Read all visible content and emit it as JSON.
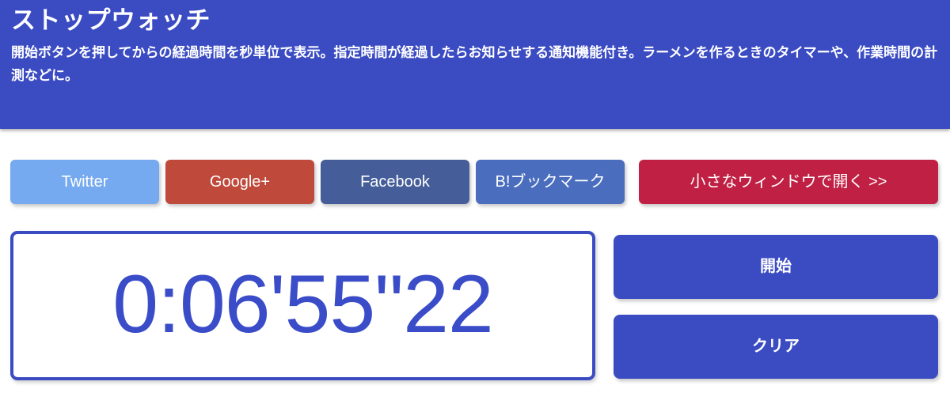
{
  "header": {
    "title": "ストップウォッチ",
    "description": "開始ボタンを押してからの経過時間を秒単位で表示。指定時間が経過したらお知らせする通知機能付き。ラーメンを作るときのタイマーや、作業時間の計測などに。",
    "background_color": "#3b4cc3",
    "text_color": "#ffffff"
  },
  "share_buttons": [
    {
      "label": "Twitter",
      "color": "#76aaf0",
      "name": "twitter"
    },
    {
      "label": "Google+",
      "color": "#bf4a3c",
      "name": "google-plus"
    },
    {
      "label": "Facebook",
      "color": "#455e99",
      "name": "facebook"
    },
    {
      "label": "B!ブックマーク",
      "color": "#4a6dbe",
      "name": "hatena-bookmark"
    }
  ],
  "open_window_button": {
    "label": "小さなウィンドウで開く >>",
    "color": "#bf2043"
  },
  "stopwatch": {
    "display": "0:06'55\"22",
    "hours": "0",
    "minutes": "06",
    "seconds": "55",
    "centiseconds": "22",
    "digit_color": "#3a4cc8",
    "border_color": "#3b4cc3"
  },
  "controls": {
    "start_label": "開始",
    "clear_label": "クリア",
    "color": "#3b4cc3"
  }
}
